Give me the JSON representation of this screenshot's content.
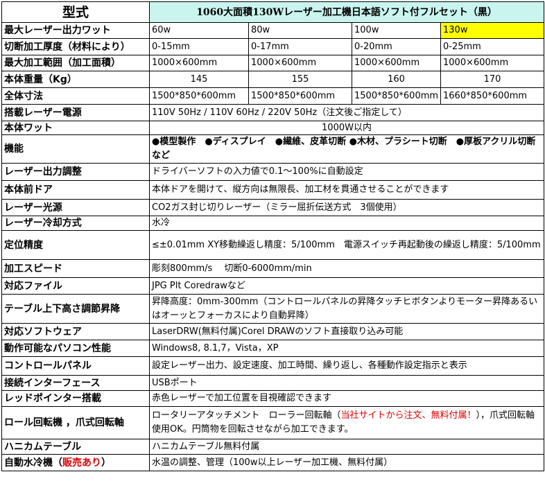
{
  "header": {
    "label": "型式",
    "title": "1060大面積130Wレーザー加工機日本語ソフト付フルセット（黒）"
  },
  "rows": {
    "power": {
      "label": "最大レーザー出力ワット",
      "values": [
        "60w",
        "80w",
        "100w",
        "130w"
      ]
    },
    "cut_thickness": {
      "label": "切断加工厚度（材料により）",
      "values": [
        "0-15mm",
        "0-17mm",
        "0-20mm",
        "0-25mm"
      ]
    },
    "work_area": {
      "label": "最大加工範囲（加工面積）",
      "values": [
        "1000×600mm",
        "1000×600mm",
        "1000×600mm",
        "1000×600mm"
      ]
    },
    "weight": {
      "label": "本体重量（Kg）",
      "values": [
        "145",
        "155",
        "160",
        "170"
      ]
    },
    "dimensions": {
      "label": "全体寸法",
      "values": [
        "1500*850*600mm",
        "1500*850*600mm",
        "1500*850*600mm",
        "1660*850*600mm"
      ]
    },
    "power_supply": {
      "label": "搭載レーザー電源",
      "value": "110V 50Hz / 110V 60Hz  / 220V 50Hz（注文後ご指定して）"
    },
    "body_watt": {
      "label": "本体ワット",
      "value": "1000W以内"
    },
    "function": {
      "label": "機能",
      "value": "●模型製作　●ディスプレイ　●繊維、皮革切断 ●木材、プラシート切断　●厚板アクリル切断 など"
    },
    "output_adjust": {
      "label": "レーザー出力調整",
      "value": "ドライバーソフトの入力値で0.1～100%に自動設定"
    },
    "front_door": {
      "label": "本体前ドア",
      "value": "本体ドアを開けて、縦方向は無限長、加工材を貫通させることができます"
    },
    "laser_source": {
      "label": "レーザー光源",
      "value": "CO2ガス封じ切りレーザー（ミラー屈折伝送方式　3個使用）"
    },
    "cooling": {
      "label": "レーザー冷却方式",
      "value": "水冷"
    },
    "precision": {
      "label": "定位精度",
      "value": "≤±0.01mm XY移動繰返し精度：5/100mm　電源スイッチ再起動後の繰返し精度：5/100mm"
    },
    "speed": {
      "label": "加工スピード",
      "value": "彫刻800mm/s　 切断0-6000mm/min"
    },
    "file_types": {
      "label": "対応ファイル",
      "value": "JPG  Plt  Coredrawなど"
    },
    "table_lift": {
      "label": "テーブル上下高さ調節昇降",
      "value": "昇降高度：0mm-300mm（コントロールパネルの昇降タッチヒボタンよりモーター昇降あるいはオーッとフォーカスにより自動昇降）"
    },
    "software": {
      "label": "対応ソフトウェア",
      "value": "LaserDRW(無料付属)Corel DRAWのソフト直接取り込み可能"
    },
    "pc": {
      "label": "動作可能なパソコン性能",
      "value": "Windows8, 8.1,7，Vista，XP"
    },
    "control_panel": {
      "label": "コントロールパネル",
      "value": "設定レーザー出力、設定速度、加工時間、繰り返し、各種動作設定指示と表示"
    },
    "interface": {
      "label": "接続インターフェース",
      "value": "USBポート"
    },
    "red_pointer": {
      "label": "レッドポインター搭載",
      "value": "赤色レーザーで加工位置を目視確認できます"
    },
    "rotary": {
      "label": "ロール回転機 ，爪式回転軸",
      "value_before": "ロータリーアタッチメント　ローラー回転軸（",
      "value_red": "当社サイトから注文、無料付属！",
      "value_after": "），爪式回転軸使用OK。円筒物を回転させながら加工できます。"
    },
    "honeycomb": {
      "label": "ハニカムテーブル",
      "value": "ハニカムテーブル無料付属"
    },
    "chiller": {
      "label_before": "自動水冷機（",
      "label_red": "販売あり",
      "label_after": "）",
      "value": "水温の調整、管理（100w以上レーザー加工機、無料付属）"
    }
  },
  "colors": {
    "header_bg": "#c9f5ee",
    "highlight": "#ffff00",
    "accent_red": "#e00000",
    "border": "#000000"
  }
}
